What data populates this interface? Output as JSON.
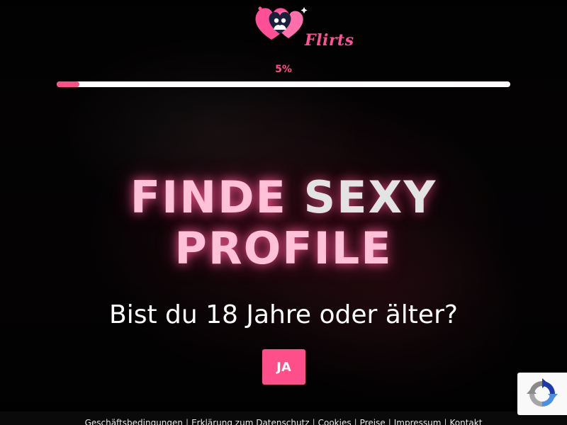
{
  "brand": {
    "name": "Flirts",
    "accent_color": "#ff4f8b",
    "logo_icon": "hearts-couple-logo"
  },
  "progress": {
    "label": "5%",
    "value_percent": 5
  },
  "headline": {
    "word1": "FINDE",
    "word2": "SEXY",
    "word3": "PROFILE"
  },
  "age_check": {
    "question": "Bist du 18 Jahre oder älter?",
    "yes_label": "JA"
  },
  "footer": {
    "links": [
      "Geschäftsbedingungen",
      "Erklärung zum Datenschutz",
      "Cookies",
      "Preise",
      "Impressum",
      "Kontakt"
    ]
  },
  "recaptcha": {
    "icon": "recaptcha-icon"
  }
}
